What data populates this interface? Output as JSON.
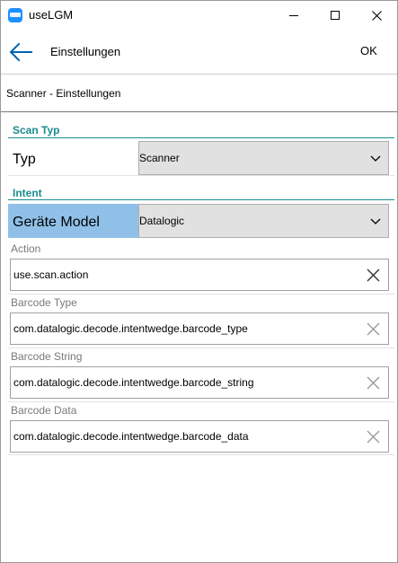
{
  "window": {
    "title": "useLGM"
  },
  "appbar": {
    "title": "Einstellungen",
    "ok_label": "OK"
  },
  "subheader": "Scanner - Einstellungen",
  "sections": {
    "scan_typ": {
      "heading": "Scan Typ",
      "typ_label": "Typ",
      "typ_value": "Scanner"
    },
    "intent": {
      "heading": "Intent",
      "model_label": "Geräte Model",
      "model_value": "Datalogic"
    }
  },
  "fields": {
    "action": {
      "label": "Action",
      "value": "use.scan.action"
    },
    "barcode_type": {
      "label": "Barcode Type",
      "value": "com.datalogic.decode.intentwedge.barcode_type"
    },
    "barcode_string": {
      "label": "Barcode String",
      "value": "com.datalogic.decode.intentwedge.barcode_string"
    },
    "barcode_data": {
      "label": "Barcode Data",
      "value": "com.datalogic.decode.intentwedge.barcode_data"
    }
  },
  "icons": {
    "app": "app-icon",
    "back": "arrow-left-icon",
    "dropdown": "chevron-down-icon",
    "clear": "close-icon"
  },
  "colors": {
    "accent": "#1a8c8f",
    "highlight": "#90c0e8",
    "back_arrow": "#0063b1"
  }
}
